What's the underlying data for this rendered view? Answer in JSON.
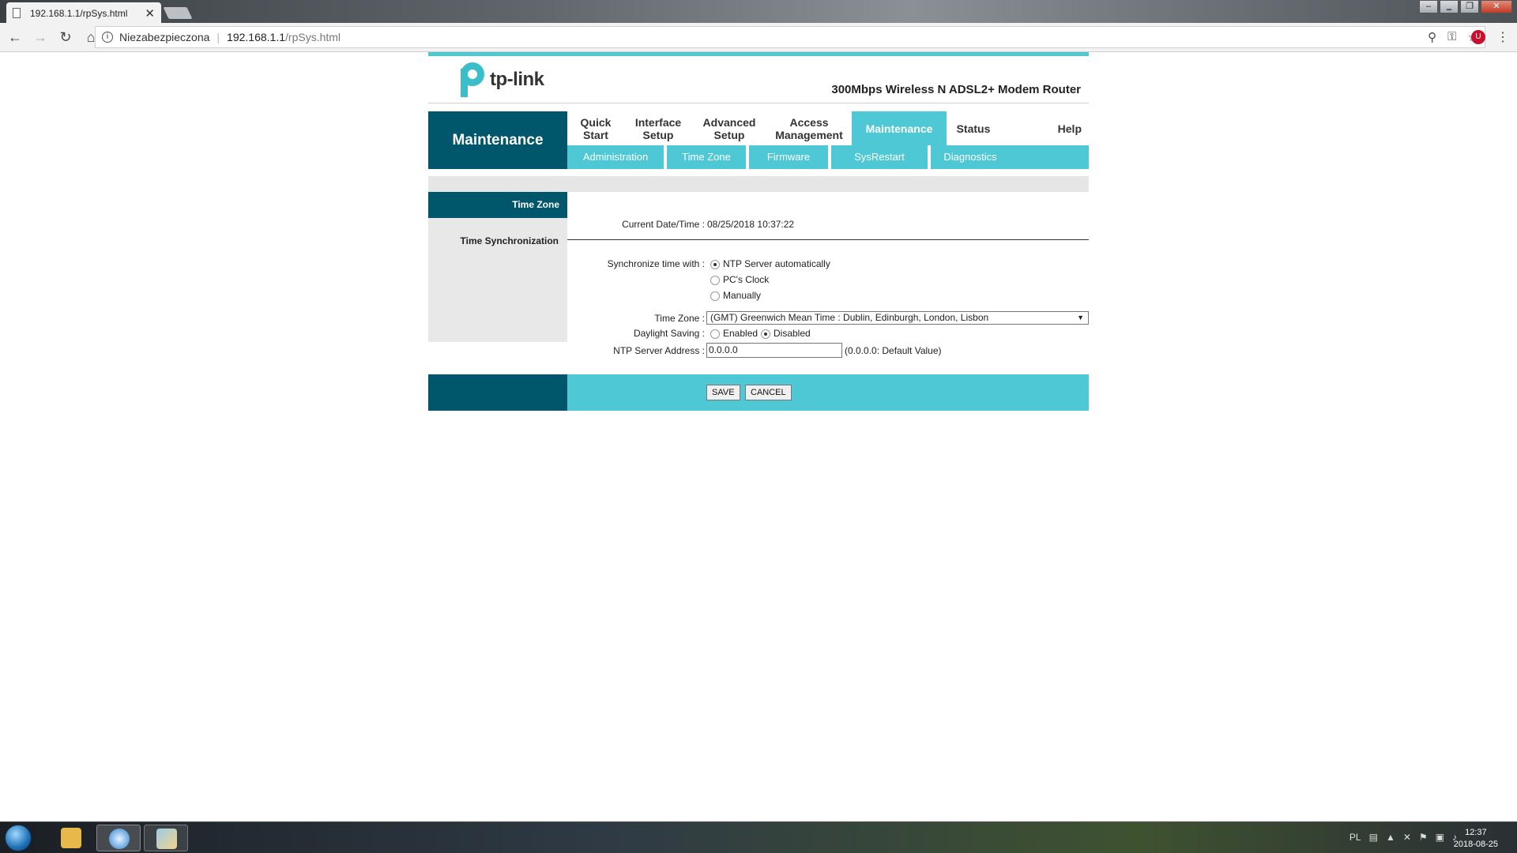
{
  "browser": {
    "tab_title": "192.168.1.1/rpSys.html",
    "security_label": "Niezabezpieczona",
    "url_host": "192.168.1.1",
    "url_path": "/rpSys.html"
  },
  "router": {
    "logo_text": "tp-link",
    "model": "300Mbps Wireless N ADSL2+ Modem Router",
    "section": "Maintenance",
    "menu": [
      {
        "label": "Quick\nStart"
      },
      {
        "label": "Interface\nSetup"
      },
      {
        "label": "Advanced\nSetup"
      },
      {
        "label": "Access\nManagement"
      },
      {
        "label": "Maintenance"
      },
      {
        "label": "Status"
      },
      {
        "label": "Help"
      }
    ],
    "submenu": [
      "Administration",
      "Time Zone",
      "Firmware",
      "SysRestart",
      "Diagnostics"
    ],
    "left": {
      "time_zone": "Time Zone",
      "time_sync": "Time Synchronization"
    },
    "form": {
      "current_label": "Current Date/Time :",
      "current_value": "08/25/2018 10:37:22",
      "sync_label": "Synchronize time with :",
      "sync_options": [
        "NTP Server automatically",
        "PC's Clock",
        "Manually"
      ],
      "sync_selected": "NTP Server automatically",
      "tz_label": "Time Zone :",
      "tz_value": "(GMT) Greenwich Mean Time : Dublin, Edinburgh, London, Lisbon",
      "ds_label": "Daylight Saving :",
      "ds_enabled": "Enabled",
      "ds_disabled": "Disabled",
      "ds_selected": "Disabled",
      "ntp_label": "NTP Server Address :",
      "ntp_value": "0.0.0.0",
      "ntp_hint": "(0.0.0.0: Default Value)"
    },
    "buttons": {
      "save": "SAVE",
      "cancel": "CANCEL"
    }
  },
  "taskbar": {
    "lang": "PL",
    "time": "12:37",
    "date": "2018-08-25"
  }
}
